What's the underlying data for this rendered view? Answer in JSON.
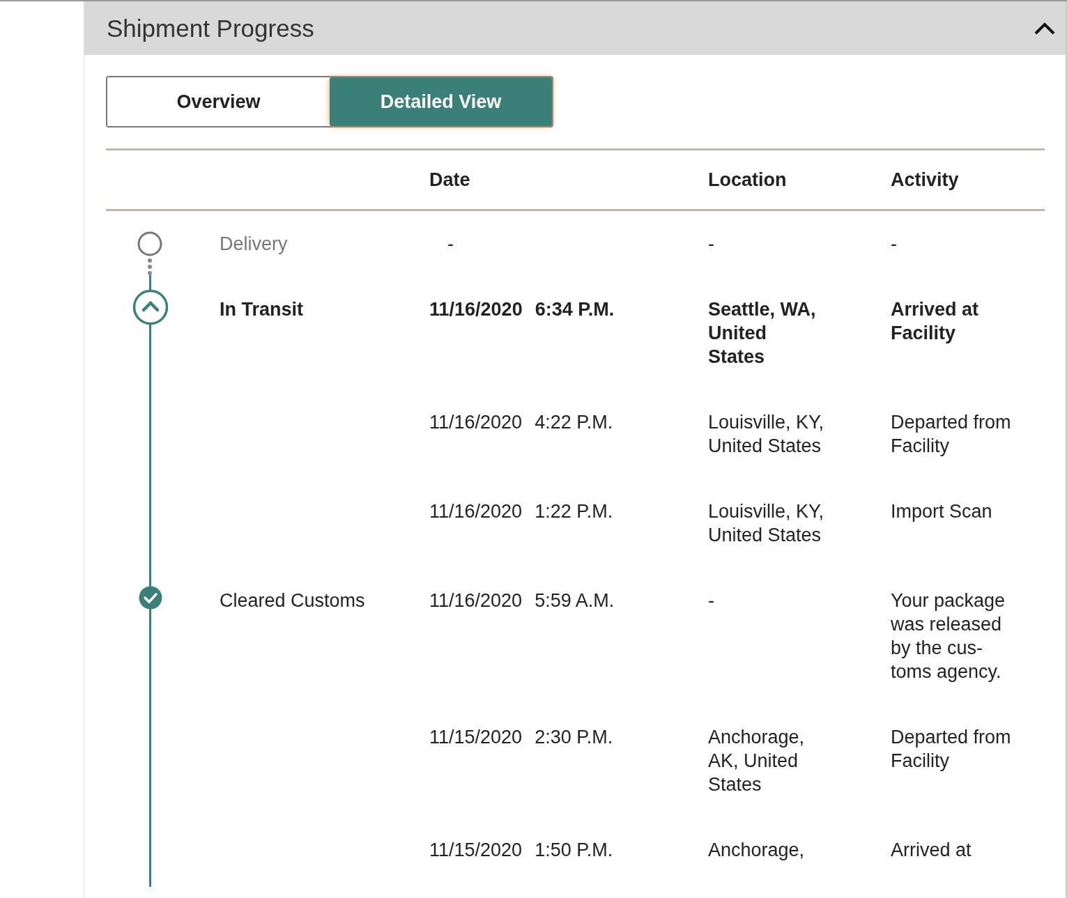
{
  "panel": {
    "title": "Shipment Progress",
    "expanded": true
  },
  "view_toggle": [
    {
      "label": "Overview",
      "selected": false
    },
    {
      "label": "Detailed View",
      "selected": true
    }
  ],
  "table": {
    "columns": [
      "Date",
      "Location",
      "Activity"
    ],
    "groups": [
      {
        "status": "Delivery",
        "kind": "pending",
        "events": [
          {
            "date": "-",
            "location": "-",
            "activity": "-",
            "emphasized": false
          }
        ]
      },
      {
        "status": "In Transit",
        "kind": "current",
        "events": [
          {
            "date": "11/16/2020",
            "time": "6:34 P.M.",
            "location": "Seattle, WA, United States",
            "activity": "Arrived at Facility",
            "emphasized": true
          },
          {
            "date": "11/16/2020",
            "time": "4:22 P.M.",
            "location": "Louisville, KY, United States",
            "activity": "Departed from Facility",
            "emphasized": false
          },
          {
            "date": "11/16/2020",
            "time": "1:22 P.M.",
            "location": "Louisville, KY, United States",
            "activity": "Import Scan",
            "emphasized": false
          }
        ]
      },
      {
        "status": "Cleared Customs",
        "kind": "done",
        "events": [
          {
            "date": "11/16/2020",
            "time": "5:59 A.M.",
            "location": "-",
            "activity": "Your package was released by the cus- toms agency.",
            "emphasized": false
          },
          {
            "date": "11/15/2020",
            "time": "2:30 P.M.",
            "location": "Anchorage, AK, United States",
            "activity": "Departed from Facility",
            "emphasized": false
          },
          {
            "date": "11/15/2020",
            "time": "1:50 P.M.",
            "location": "Anchorage,",
            "activity": "Arrived at",
            "emphasized": false
          }
        ]
      }
    ]
  }
}
